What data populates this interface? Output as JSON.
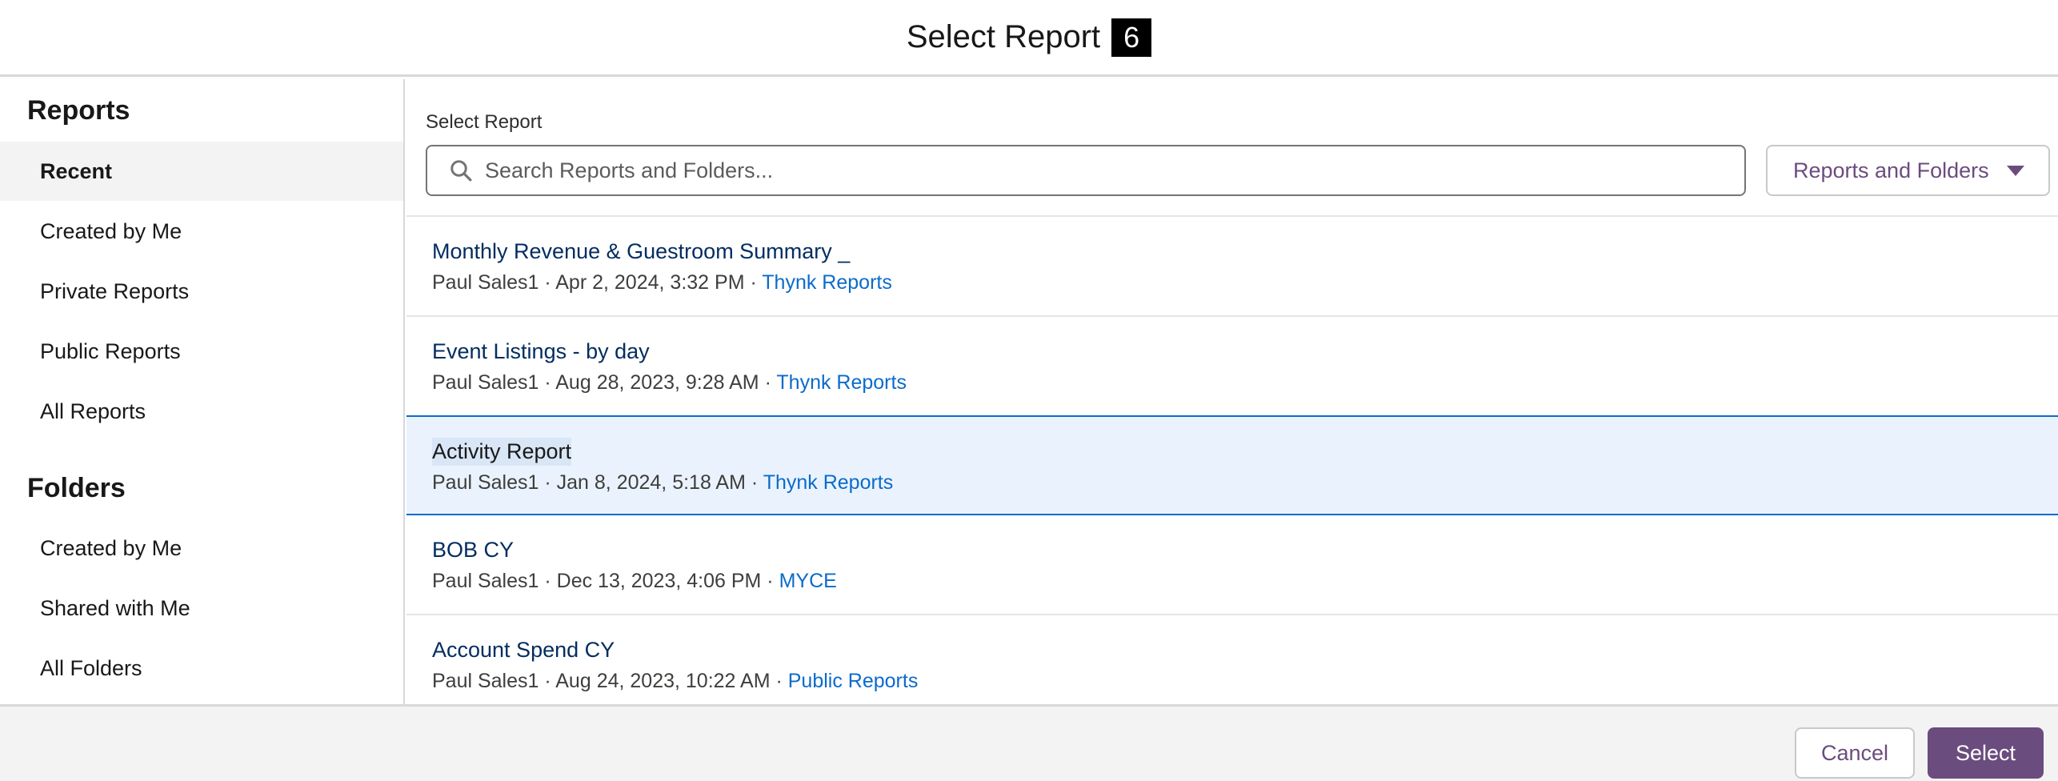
{
  "modal": {
    "title": "Select Report",
    "badge": "6"
  },
  "sidebar": {
    "reports_heading": "Reports",
    "reports_items": [
      {
        "label": "Recent",
        "active": true
      },
      {
        "label": "Created by Me"
      },
      {
        "label": "Private Reports"
      },
      {
        "label": "Public Reports"
      },
      {
        "label": "All Reports"
      }
    ],
    "folders_heading": "Folders",
    "folders_items": [
      {
        "label": "Created by Me"
      },
      {
        "label": "Shared with Me"
      },
      {
        "label": "All Folders"
      }
    ]
  },
  "search": {
    "label": "Select Report",
    "placeholder": "Search Reports and Folders...",
    "value": ""
  },
  "filter": {
    "label": "Reports and Folders"
  },
  "reports": [
    {
      "title": "Monthly Revenue & Guestroom Summary _",
      "meta": "Paul Sales1 · Apr 2, 2024, 3:32 PM · ",
      "folder": "Thynk Reports"
    },
    {
      "title": "Event Listings - by day",
      "meta": "Paul Sales1 · Aug 28, 2023, 9:28 AM · ",
      "folder": "Thynk Reports"
    },
    {
      "title": "Activity Report",
      "meta": "Paul Sales1 · Jan 8, 2024, 5:18 AM · ",
      "folder": "Thynk Reports",
      "selected": true
    },
    {
      "title": "BOB CY",
      "meta": "Paul Sales1 · Dec 13, 2023, 4:06 PM · ",
      "folder": "MYCE"
    },
    {
      "title": "Account Spend CY",
      "meta": "Paul Sales1 · Aug 24, 2023, 10:22 AM · ",
      "folder": "Public Reports"
    }
  ],
  "footer": {
    "cancel_label": "Cancel",
    "select_label": "Select"
  },
  "colors": {
    "brand": "#6b4c7e",
    "link": "#0b6bcb",
    "selected_bg": "#eaf3fd"
  }
}
